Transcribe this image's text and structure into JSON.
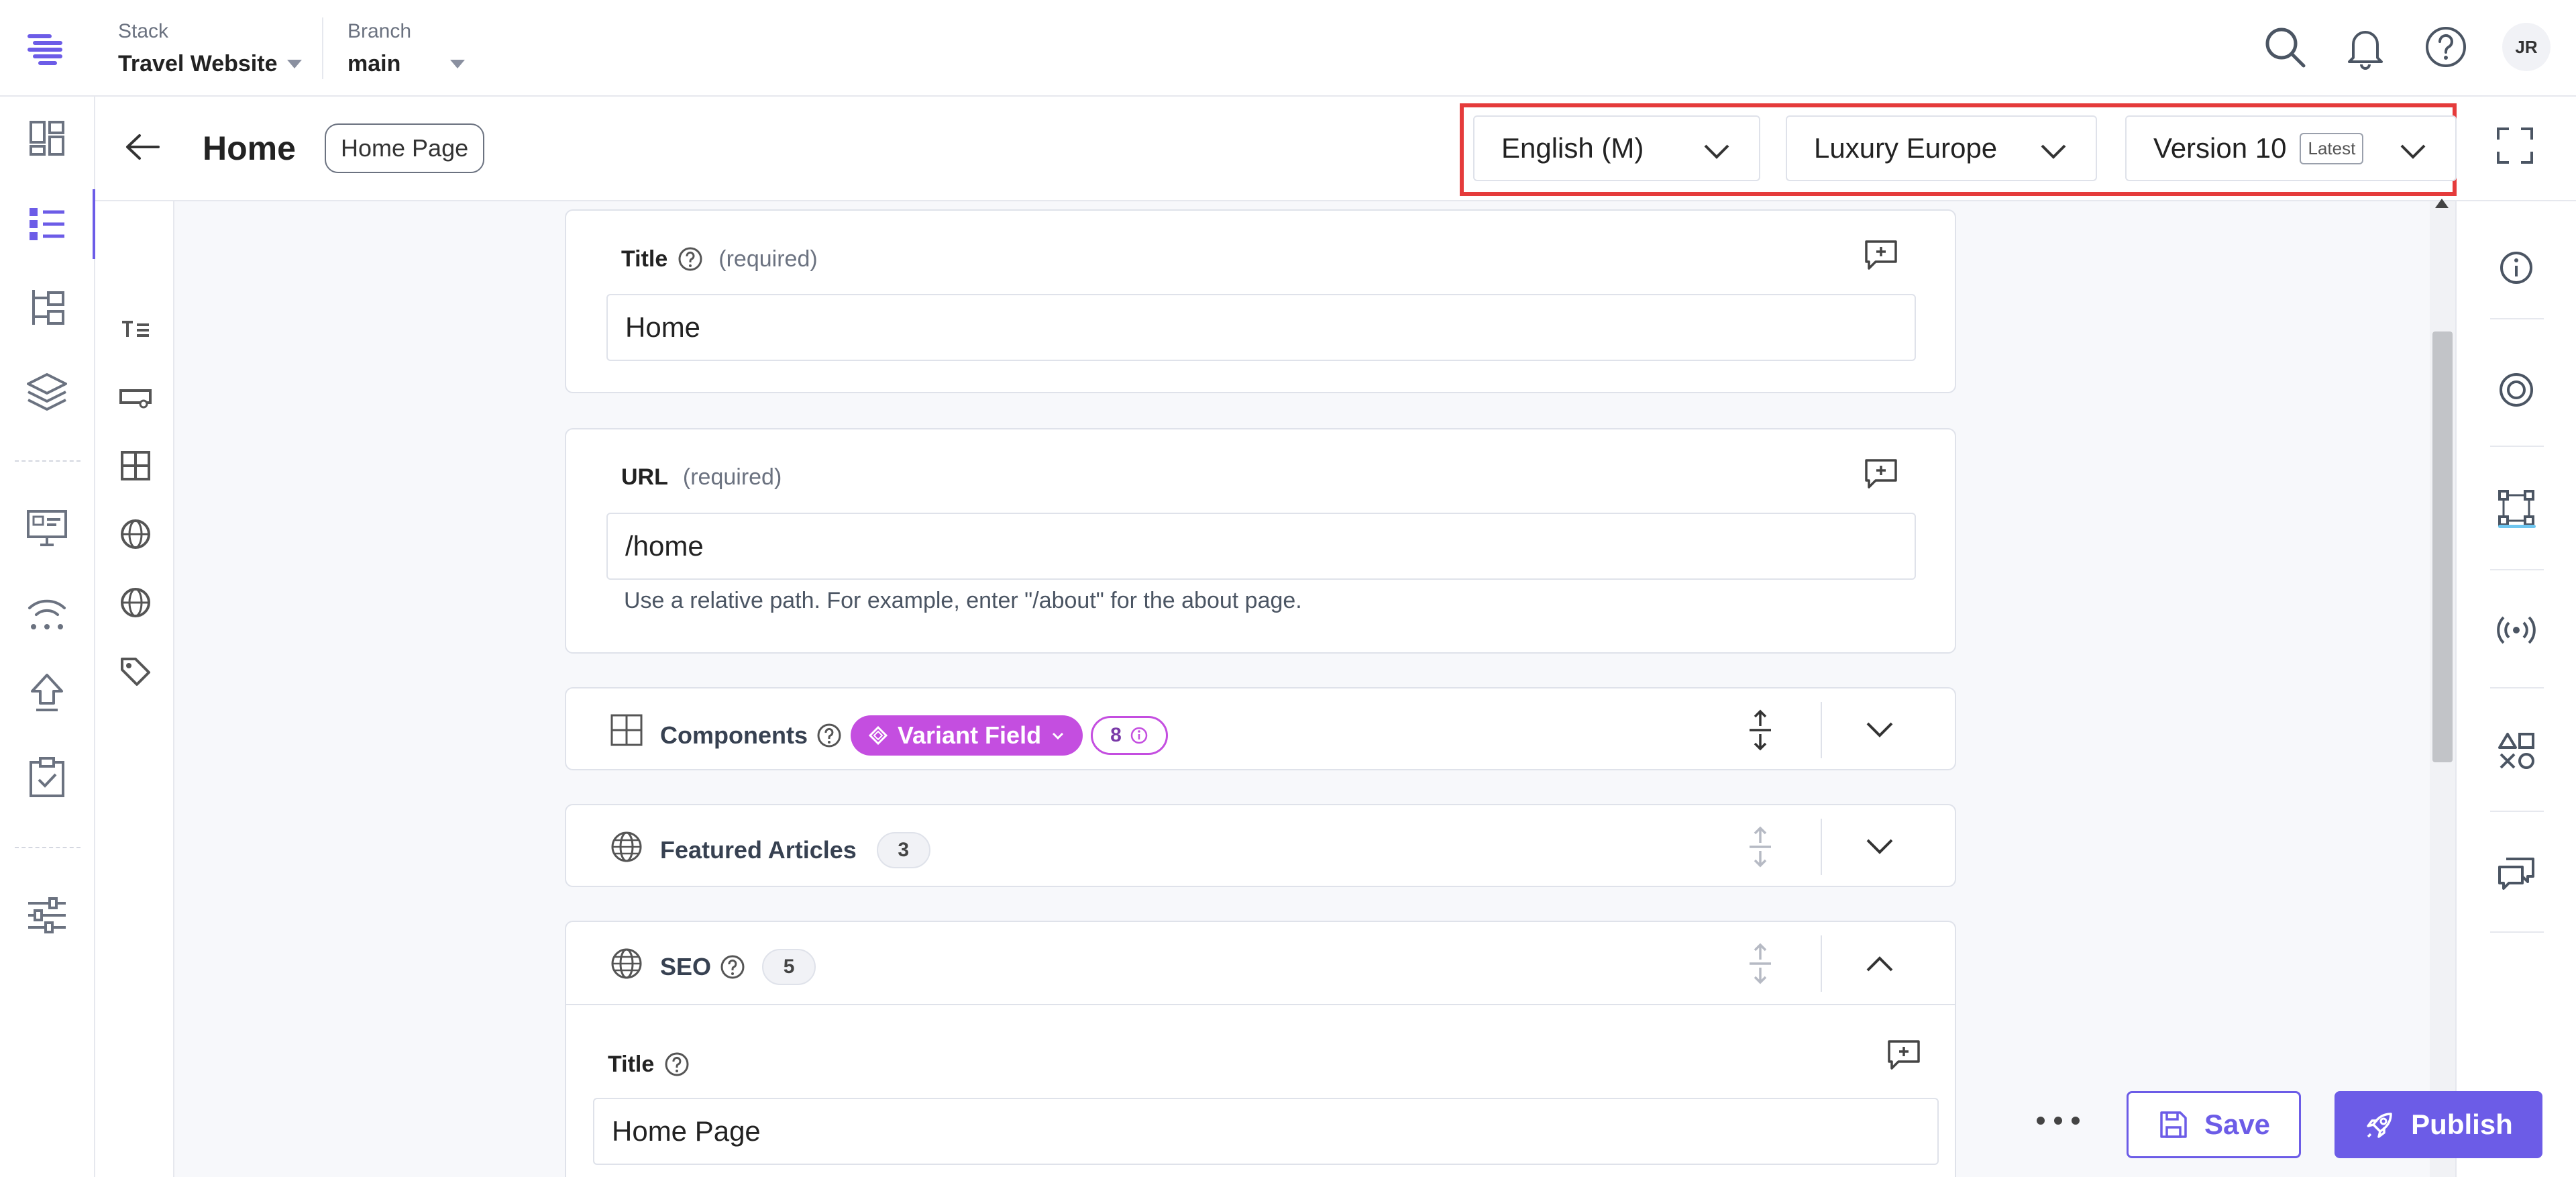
{
  "topbar": {
    "stack_label": "Stack",
    "stack_value": "Travel Website",
    "branch_label": "Branch",
    "branch_value": "main",
    "avatar_initials": "JR"
  },
  "entry": {
    "title": "Home",
    "content_type": "Home Page"
  },
  "selectors": {
    "locale": "English (M)",
    "variant": "Luxury Europe",
    "version": "Version 10",
    "version_tag": "Latest"
  },
  "fields": {
    "title_label": "Title",
    "title_required": "(required)",
    "title_value": "Home",
    "url_label": "URL",
    "url_required": "(required)",
    "url_value": "/home",
    "url_hint": "Use a relative path. For example, enter \"/about\" for the about page."
  },
  "groups": {
    "components_label": "Components",
    "variant_field_label": "Variant Field",
    "components_count": "8",
    "featured_label": "Featured Articles",
    "featured_count": "3",
    "seo_label": "SEO",
    "seo_count": "5",
    "seo_title_label": "Title",
    "seo_title_value": "Home Page"
  },
  "actions": {
    "save_label": "Save",
    "publish_label": "Publish"
  },
  "colors": {
    "brand": "#6c5ce7",
    "variant": "#c44ee0",
    "highlight": "#e53b3b"
  }
}
